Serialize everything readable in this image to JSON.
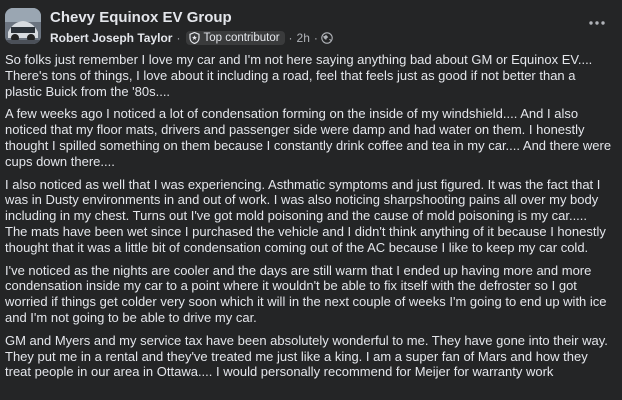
{
  "post": {
    "group_name": "Chevy Equinox EV Group",
    "author": "Robert Joseph Taylor",
    "badge": "Top contributor",
    "time": "2h",
    "paragraphs": [
      "So folks just remember I love my car and I'm not here saying anything bad about GM or Equinox EV.... There's tons of things, I love about it including a road, feel that feels just as good if not better than a plastic Buick from the '80s....",
      "A few weeks ago I noticed a lot of condensation forming on the inside of my windshield.... And I also noticed that my floor mats, drivers and passenger side were damp and had water on them. I honestly thought I spilled something on them because I constantly drink coffee and tea in my car.... And there were cups down there....",
      "I also noticed as well that I was experiencing. Asthmatic symptoms and just figured. It was the fact that I was in Dusty environments in and out of work. I was also noticing sharpshooting pains all over my body including in my chest.   Turns out I've got mold poisoning and the cause of mold poisoning is my car..... The mats have been wet since I purchased the vehicle and I didn't think anything of it because I honestly thought that it was a little bit of condensation coming out of the AC because I like to keep my car cold.",
      "I've noticed as the nights are cooler and the days are still warm that I ended up having more and more condensation inside my car to a point where it wouldn't be able to fix itself with the defroster so I got worried if things get colder very soon which it will in the next couple of weeks I'm going to end up with ice and I'm not going to be able to drive my car.",
      "GM and Myers and my service tax have been  absolutely wonderful to me. They have gone into their way. They put me in a rental and they've treated me just like a king. I am a super fan of Mars and how they treat people in our area in Ottawa.... I would personally recommend for Meijer for warranty work"
    ]
  },
  "icons": {
    "badge": "shield-star-icon",
    "audience": "globe-icon",
    "menu": "more-horizontal-icon"
  }
}
